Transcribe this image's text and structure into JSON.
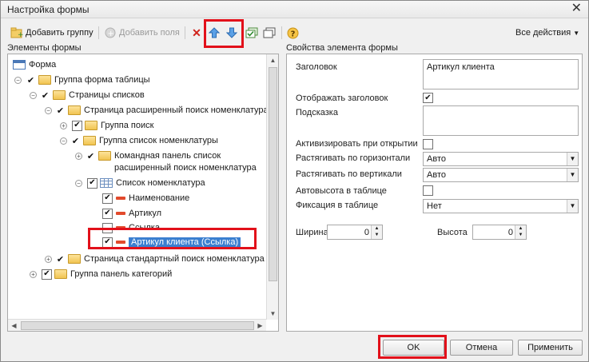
{
  "window": {
    "title": "Настройка формы"
  },
  "toolbar": {
    "add_group": "Добавить группу",
    "add_fields": "Добавить поля",
    "all_actions": "Все действия"
  },
  "left_panel": {
    "heading": "Элементы формы"
  },
  "tree": [
    {
      "label": "Форма",
      "icon": "form-icon"
    },
    {
      "label": "Группа форма таблицы",
      "icon": "folder-icon"
    },
    {
      "label": "Страницы списков",
      "icon": "folder-icon"
    },
    {
      "label": "Страница расширенный поиск номенклатура",
      "icon": "folder-icon"
    },
    {
      "label": "Группа поиск",
      "icon": "folder-icon"
    },
    {
      "label": "Группа список номенклатуры",
      "icon": "folder-icon"
    },
    {
      "label": "Командная панель список",
      "label2": "расширенный поиск номенклатура",
      "icon": "folder-icon"
    },
    {
      "label": "Список номенклатура",
      "icon": "table-icon"
    },
    {
      "label": "Наименование",
      "icon": "field-icon"
    },
    {
      "label": "Артикул",
      "icon": "field-icon"
    },
    {
      "label": "Ссылка",
      "icon": "field-icon"
    },
    {
      "label": "Артикул клиента (Ссылка)",
      "icon": "field-icon",
      "selected": true
    },
    {
      "label": "Страница стандартный поиск номенклатура",
      "icon": "folder-icon"
    },
    {
      "label": "Группа панель категорий",
      "icon": "folder-icon"
    }
  ],
  "right_panel": {
    "heading": "Свойства элемента формы"
  },
  "properties": {
    "title_label": "Заголовок",
    "title_value": "Артикул клиента",
    "show_title_label": "Отображать заголовок",
    "show_title_checked": true,
    "hint_label": "Подсказка",
    "hint_value": "",
    "activate_label": "Активизировать при открытии",
    "activate_checked": false,
    "stretch_h_label": "Растягивать по горизонтали",
    "stretch_h_value": "Авто",
    "stretch_v_label": "Растягивать по вертикали",
    "stretch_v_value": "Авто",
    "autoheight_label": "Автовысота в таблице",
    "autoheight_checked": false,
    "fix_label": "Фиксация в таблице",
    "fix_value": "Нет",
    "width_label": "Ширина",
    "width_value": "0",
    "height_label": "Высота",
    "height_value": "0"
  },
  "buttons": {
    "ok": "OK",
    "cancel": "Отмена",
    "apply": "Применить"
  },
  "colors": {
    "highlight": "#e2101a",
    "selection": "#3b7fd0"
  }
}
